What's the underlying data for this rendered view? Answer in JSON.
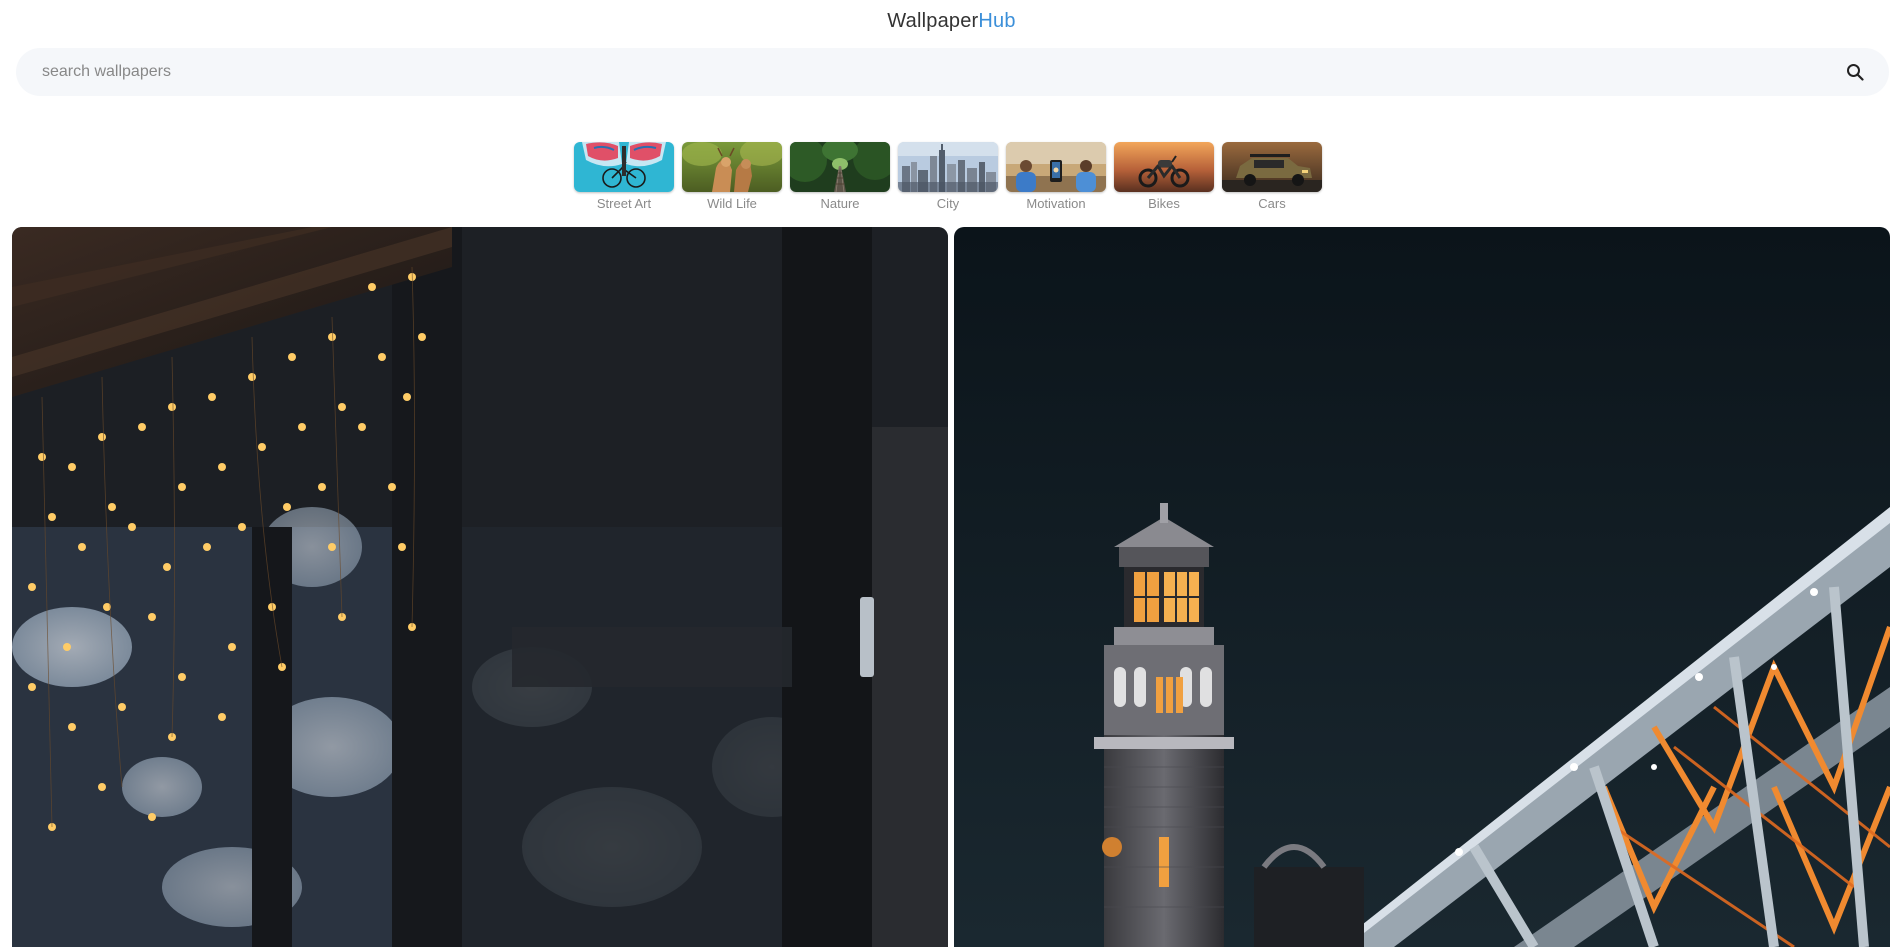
{
  "header": {
    "logo_main": "Wallpaper",
    "logo_accent": "Hub"
  },
  "search": {
    "placeholder": "search wallpapers",
    "value": "",
    "icon": "search-icon"
  },
  "categories": [
    {
      "label": "Street Art"
    },
    {
      "label": "Wild Life"
    },
    {
      "label": "Nature"
    },
    {
      "label": "City"
    },
    {
      "label": "Motivation"
    },
    {
      "label": "Bikes"
    },
    {
      "label": "Cars"
    }
  ],
  "colors": {
    "accent": "#3b8fd9",
    "search_bg": "#f5f7fa",
    "label": "#8a8a8a"
  }
}
